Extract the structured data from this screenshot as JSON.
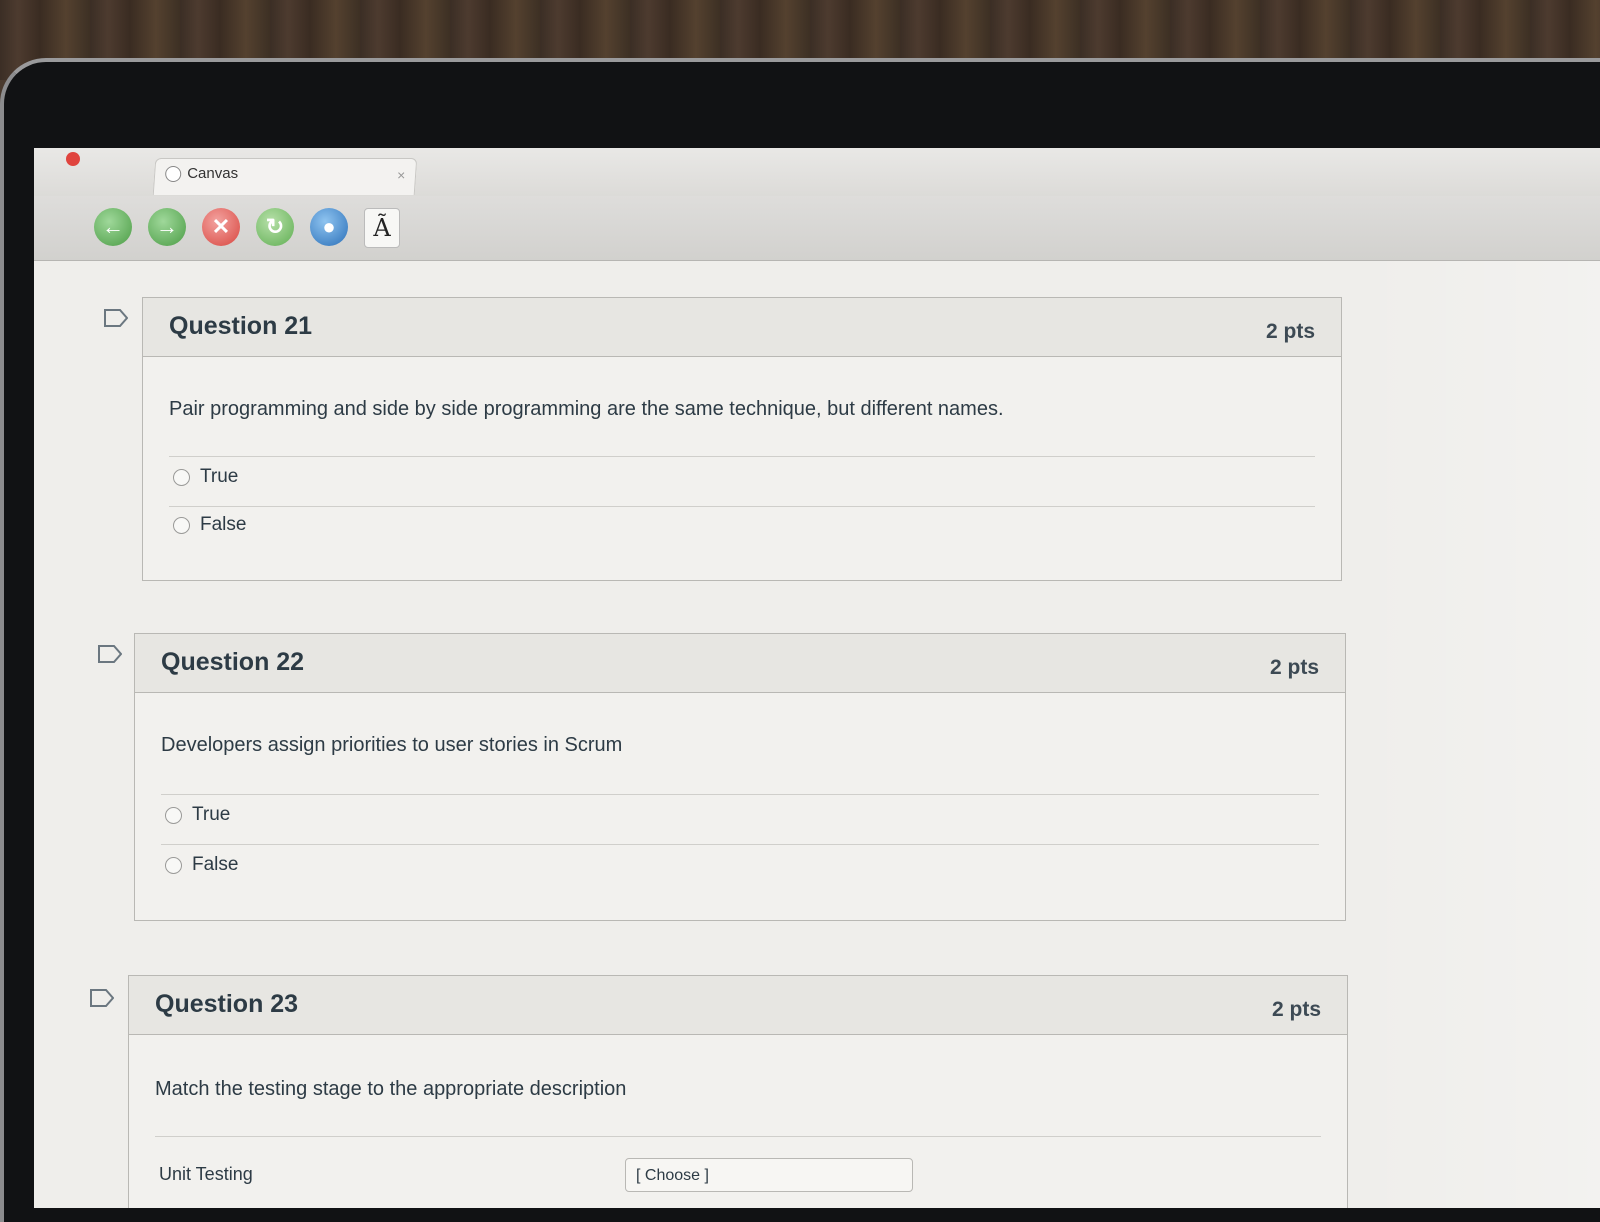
{
  "browser": {
    "tab_title": "Canvas",
    "tab_close": "×",
    "toolbar": {
      "back_icon": "arrow-left-icon",
      "forward_icon": "arrow-right-icon",
      "stop_icon": "close-icon",
      "reload_icon": "refresh-icon",
      "home_icon": "globe-icon",
      "font_button": "Ã"
    }
  },
  "questions": [
    {
      "title": "Question 21",
      "points": "2 pts",
      "text": "Pair programming and side by side programming are the same technique, but different names.",
      "answers": [
        "True",
        "False"
      ]
    },
    {
      "title": "Question 22",
      "points": "2 pts",
      "text": "Developers assign priorities to user stories in Scrum",
      "answers": [
        "True",
        "False"
      ]
    },
    {
      "title": "Question 23",
      "points": "2 pts",
      "text": "Match the testing stage to the appropriate description",
      "match_rows": [
        {
          "label": "Unit Testing",
          "select": "[ Choose ]"
        }
      ]
    }
  ]
}
